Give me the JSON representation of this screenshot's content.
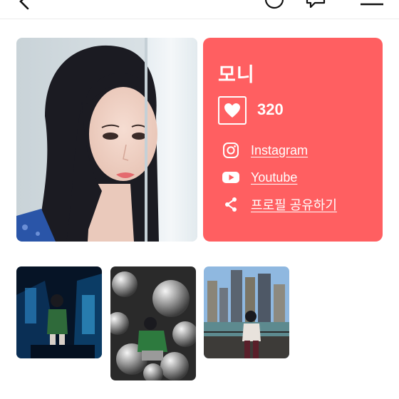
{
  "profile": {
    "name": "모니",
    "like_count": "320",
    "links": [
      {
        "label": "Instagram",
        "icon": "instagram-icon"
      },
      {
        "label": "Youtube",
        "icon": "youtube-icon"
      },
      {
        "label": "프로필 공유하기",
        "icon": "share-icon"
      }
    ]
  },
  "colors": {
    "card_background": "#ff5f61",
    "text_on_card": "#ffffff"
  },
  "header_icons": [
    "back-arrow-icon",
    "info-icon",
    "chat-bubble-icon",
    "hamburger-menu-icon"
  ]
}
